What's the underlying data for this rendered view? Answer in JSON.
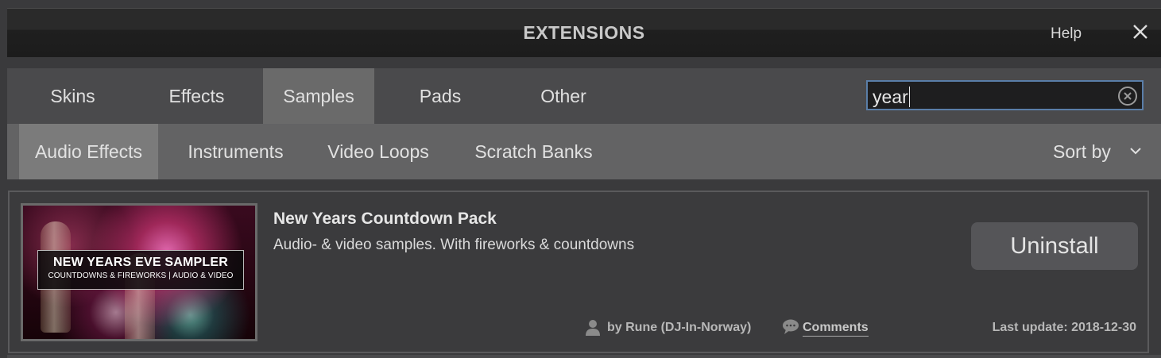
{
  "window": {
    "title": "EXTENSIONS",
    "help_label": "Help",
    "close_icon": "close-icon"
  },
  "tabs": [
    {
      "label": "Skins",
      "active": false
    },
    {
      "label": "Effects",
      "active": false
    },
    {
      "label": "Samples",
      "active": true
    },
    {
      "label": "Pads",
      "active": false
    },
    {
      "label": "Other",
      "active": false
    }
  ],
  "search": {
    "value": "year",
    "clear_icon": "clear-circle-icon"
  },
  "subtabs": [
    {
      "label": "Audio Effects",
      "active": true
    },
    {
      "label": "Instruments",
      "active": false
    },
    {
      "label": "Video Loops",
      "active": false
    },
    {
      "label": "Scratch Banks",
      "active": false
    }
  ],
  "sort": {
    "label": "Sort by",
    "icon": "chevron-down-icon"
  },
  "items": [
    {
      "thumbnail": {
        "line1": "NEW YEARS EVE SAMPLER",
        "line2": "COUNTDOWNS & FIREWORKS | AUDIO & VIDEO"
      },
      "title": "New Years Countdown Pack",
      "description": "Audio- & video samples. With fireworks & countdowns",
      "action_label": "Uninstall",
      "author": "by Rune (DJ-In-Norway)",
      "comments_label": "Comments",
      "last_update": "Last update: 2018-12-30"
    }
  ],
  "colors": {
    "accent_border": "#5a7ea8",
    "active_tab": "#6a6a6a",
    "active_subtab": "#7b7b7b"
  }
}
